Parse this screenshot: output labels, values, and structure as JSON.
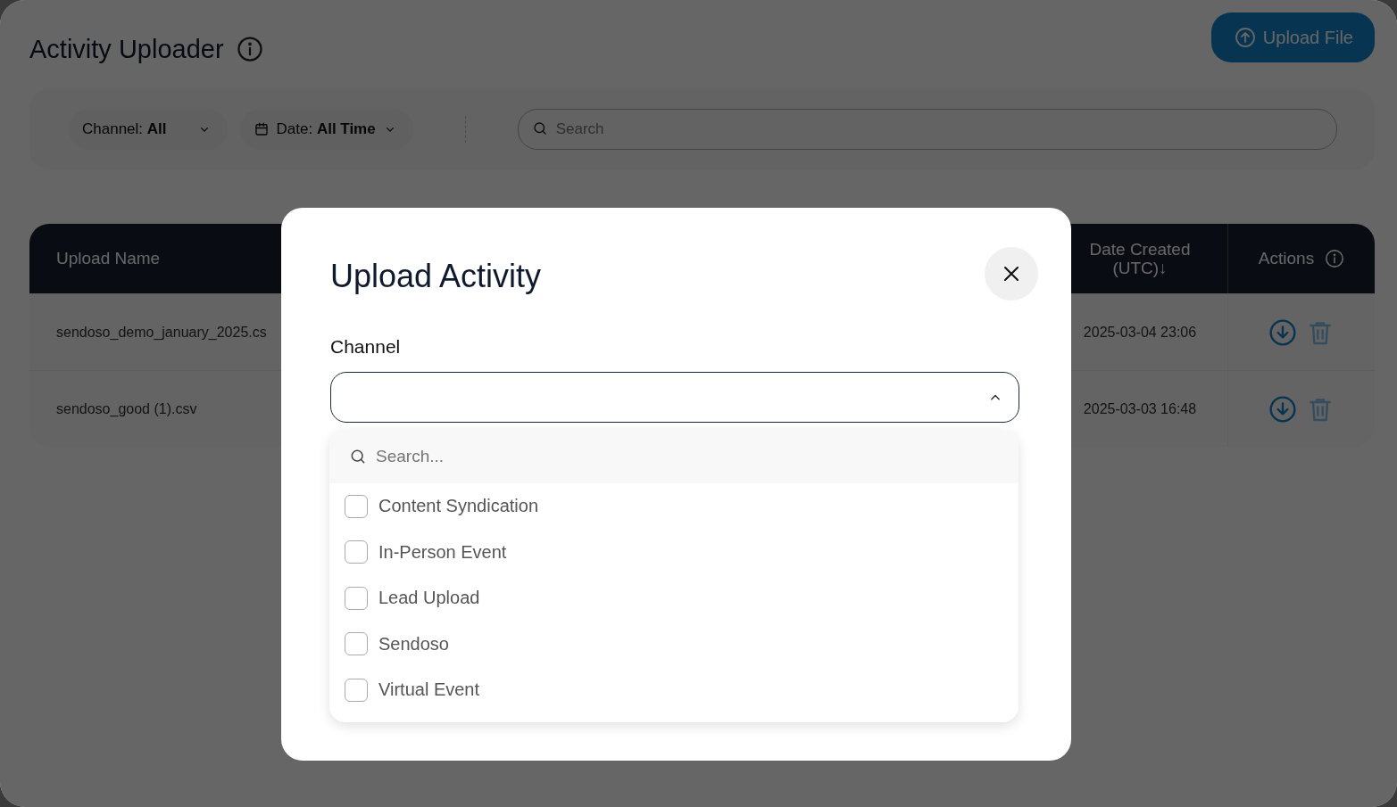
{
  "page": {
    "title": "Activity Uploader",
    "upload_button": "Upload File"
  },
  "filters": [
    {
      "kind": "dropdown",
      "label": "Channel:",
      "value": "All"
    },
    {
      "kind": "date",
      "label": "Date:",
      "value": "All Time"
    }
  ],
  "search": {
    "placeholder": "Search"
  },
  "table": {
    "columns": [
      "Upload Name",
      "Date Created (UTC)↓",
      "Actions"
    ],
    "rows": [
      {
        "upload_name": "sendoso_demo_january_2025.cs",
        "date_created": "2025-03-04 23:06"
      },
      {
        "upload_name": "sendoso_good (1).csv",
        "date_created": "2025-03-03 16:48"
      }
    ]
  },
  "modal": {
    "title": "Upload Activity",
    "field_label": "Channel",
    "select": {
      "expanded": true
    },
    "dropdown": {
      "search_placeholder": "Search...",
      "options": [
        {
          "label": "Content Syndication",
          "checked": false
        },
        {
          "label": "In-Person Event",
          "checked": false
        },
        {
          "label": "Lead Upload",
          "checked": false
        },
        {
          "label": "Sendoso",
          "checked": false
        },
        {
          "label": "Virtual Event",
          "checked": false
        }
      ]
    }
  }
}
